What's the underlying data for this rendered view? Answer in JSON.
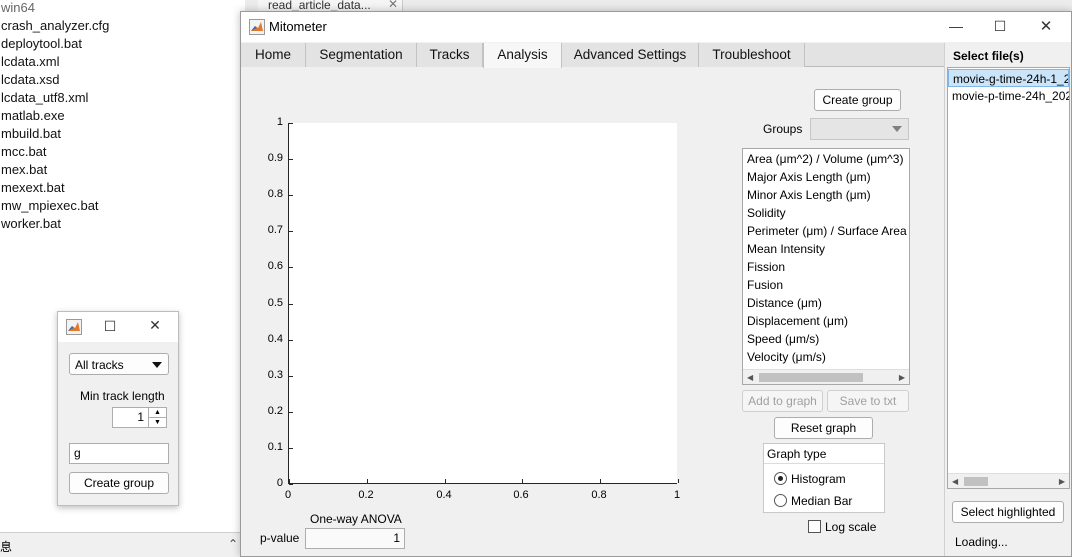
{
  "background": {
    "files": [
      "win64",
      "crash_analyzer.cfg",
      "deploytool.bat",
      "lcdata.xml",
      "lcdata.xsd",
      "lcdata_utf8.xml",
      "matlab.exe",
      "mbuild.bat",
      "mcc.bat",
      "mex.bat",
      "mexext.bat",
      "mw_mpiexec.bat",
      "worker.bat"
    ],
    "editor_tab": "read_article_data...",
    "editor_tab_close": "✕",
    "status_left": "息"
  },
  "small_window": {
    "dropdown_value": "All tracks",
    "min_track_label": "Min track length",
    "min_track_value": "1",
    "group_name_value": "g",
    "create_group_label": "Create group"
  },
  "main_window": {
    "title": "Mitometer",
    "window_controls": {
      "minimize": "—",
      "maximize": "☐",
      "close": "✕"
    },
    "tabs": [
      {
        "label": "Home"
      },
      {
        "label": "Segmentation"
      },
      {
        "label": "Tracks"
      },
      {
        "label": "Analysis"
      },
      {
        "label": "Advanced Settings"
      },
      {
        "label": "Troubleshoot"
      }
    ],
    "active_tab": "Analysis",
    "file_panel": {
      "title": "Select file(s)",
      "files": [
        "movie-g-time-24h-1_2",
        "movie-p-time-24h_202"
      ],
      "select_highlighted_label": "Select highlighted",
      "status": "Loading..."
    },
    "analysis": {
      "create_group_label": "Create group",
      "groups_label": "Groups",
      "groups_value": "",
      "measures": [
        "Area (μm^2) / Volume (μm^3)",
        "Major Axis Length (μm)",
        "Minor Axis Length (μm)",
        "Solidity",
        "Perimeter (μm) / Surface Area",
        "Mean Intensity",
        "Fission",
        "Fusion",
        "Distance (μm)",
        "Displacement (μm)",
        "Speed (μm/s)",
        "Velocity (μm/s)"
      ],
      "add_to_graph_label": "Add to graph",
      "save_to_txt_label": "Save to txt",
      "reset_graph_label": "Reset graph",
      "graph_type_title": "Graph type",
      "graph_types": [
        "Histogram",
        "Median Bar"
      ],
      "graph_type_selected": "Histogram",
      "log_scale_label": "Log scale",
      "log_scale_checked": false,
      "anova_label": "One-way ANOVA",
      "pvalue_label": "p-value",
      "pvalue_value": "1"
    },
    "plot": {
      "y_ticks": [
        "0",
        "0.1",
        "0.2",
        "0.3",
        "0.4",
        "0.5",
        "0.6",
        "0.7",
        "0.8",
        "0.9",
        "1"
      ],
      "x_ticks": [
        "0",
        "0.2",
        "0.4",
        "0.6",
        "0.8",
        "1"
      ],
      "xlim": [
        0,
        1
      ],
      "ylim": [
        0,
        1
      ]
    }
  }
}
